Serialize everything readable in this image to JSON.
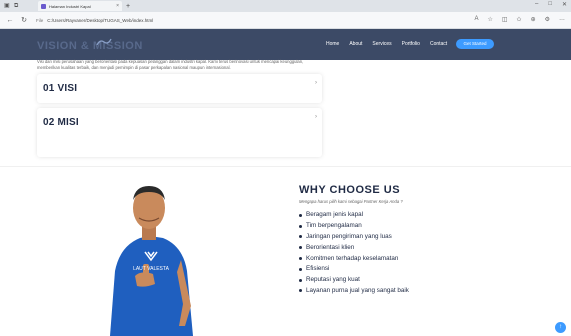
{
  "browser": {
    "tab_title": "Halaman Industri Kapal",
    "tab_close": "×",
    "new_tab": "+",
    "url": "C:/Users/Rayvaner/Desktop/TUGAS_Web/index.html",
    "url_info": "File"
  },
  "site": {
    "logo": "VISION & MISSION",
    "nav": [
      "Home",
      "About",
      "Services",
      "Portfolio",
      "Contact"
    ],
    "cta": "Get Started"
  },
  "intro": "Visi dan misi perusahaan yang berorientasi pada kepuasan pelanggan dalam industri kapal. Kami terus berinovasi untuk mencapai keunggulan, memberikan kualitas terbaik, dan menjadi pemimpin di pasar perkapalan nasional maupun internasional.",
  "cards": [
    {
      "title": "01 VISI"
    },
    {
      "title": "02 MISI"
    }
  ],
  "why": {
    "title": "WHY CHOOSE US",
    "subtitle": "Mengapa harus pilih kami sebagai Partner Kerja Anda ?",
    "items": [
      "Beragam jenis kapal",
      "Tim berpengalaman",
      "Jaringan pengiriman yang luas",
      "Berorientasi klien",
      "Komitmen terhadap keselamatan",
      "Efisiensi",
      "Reputasi yang kuat",
      "Layanan purna jual yang sangat baik"
    ]
  },
  "person_shirt_text": "LAUT VALESTA",
  "colors": {
    "header": "#3c4a66",
    "accent": "#3d9bff",
    "heading": "#1f2a44"
  }
}
